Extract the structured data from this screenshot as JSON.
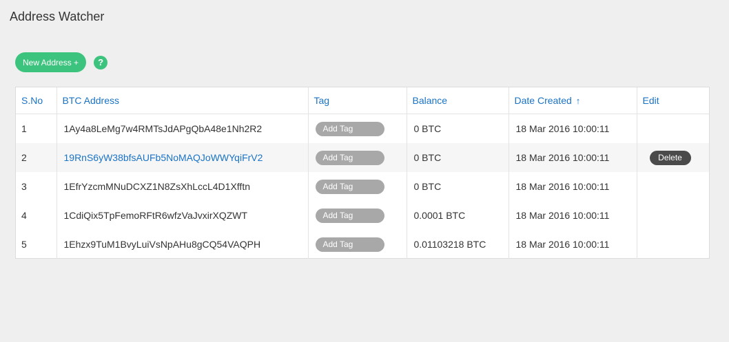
{
  "header": {
    "title": "Address Watcher"
  },
  "toolbar": {
    "new_address_label": "New Address +",
    "help_glyph": "?"
  },
  "table": {
    "columns": {
      "sno": "S.No",
      "address": "BTC Address",
      "tag": "Tag",
      "balance": "Balance",
      "date": "Date Created",
      "date_sort_glyph": "↑",
      "edit": "Edit"
    },
    "rows": [
      {
        "sno": "1",
        "address": "1Ay4a8LeMg7w4RMTsJdAPgQbA48e1Nh2R2",
        "tag_label": "Add Tag",
        "balance": "0 BTC",
        "date": "18 Mar 2016 10:00:11"
      },
      {
        "sno": "2",
        "address": "19RnS6yW38bfsAUFb5NoMAQJoWWYqiFrV2",
        "tag_label": "Add Tag",
        "balance": "0 BTC",
        "date": "18 Mar 2016 10:00:11",
        "delete_label": "Delete"
      },
      {
        "sno": "3",
        "address": "1EfrYzcmMNuDCXZ1N8ZsXhLccL4D1Xfftn",
        "tag_label": "Add Tag",
        "balance": "0 BTC",
        "date": "18 Mar 2016 10:00:11"
      },
      {
        "sno": "4",
        "address": "1CdiQix5TpFemoRFtR6wfzVaJvxirXQZWT",
        "tag_label": "Add Tag",
        "balance": "0.0001 BTC",
        "date": "18 Mar 2016 10:00:11"
      },
      {
        "sno": "5",
        "address": "1Ehzx9TuM1BvyLuiVsNpAHu8gCQ54VAQPH",
        "tag_label": "Add Tag",
        "balance": "0.01103218 BTC",
        "date": "18 Mar 2016 10:00:11"
      }
    ]
  },
  "colors": {
    "accent_green": "#3cc37d",
    "link_blue": "#1a73c6",
    "tag_gray": "#a8a8a8",
    "delete_dark": "#4a4a4a"
  }
}
